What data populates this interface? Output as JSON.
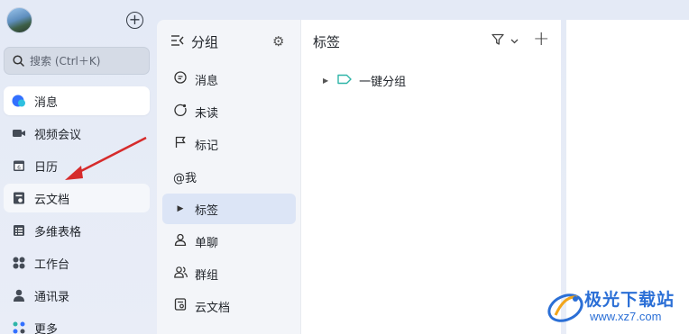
{
  "nav": {
    "search_placeholder": "搜索 (Ctrl＋K)",
    "items": [
      {
        "label": "消息",
        "icon": "message-icon"
      },
      {
        "label": "视频会议",
        "icon": "video-icon"
      },
      {
        "label": "日历",
        "icon": "calendar-icon"
      },
      {
        "label": "云文档",
        "icon": "document-icon"
      },
      {
        "label": "多维表格",
        "icon": "table-icon"
      },
      {
        "label": "工作台",
        "icon": "workspace-icon"
      },
      {
        "label": "通讯录",
        "icon": "contacts-icon"
      },
      {
        "label": "更多",
        "icon": "more-icon"
      }
    ],
    "calendar_day": "6"
  },
  "mid": {
    "title": "分组",
    "items": [
      {
        "label": "消息",
        "icon": "chat-bubble-icon"
      },
      {
        "label": "未读",
        "icon": "unread-icon"
      },
      {
        "label": "标记",
        "icon": "flag-icon"
      },
      {
        "label": "@我",
        "icon": "at-icon"
      },
      {
        "label": "标签",
        "icon": "expand-triangle-icon"
      },
      {
        "label": "单聊",
        "icon": "person-icon"
      },
      {
        "label": "群组",
        "icon": "group-icon"
      },
      {
        "label": "云文档",
        "icon": "doc-icon"
      }
    ]
  },
  "content": {
    "title": "标签",
    "group_label": "一键分组"
  },
  "watermark": {
    "name": "极光下载站",
    "url": "www.xz7.com"
  },
  "colors": {
    "accent": "#3370ff",
    "active_bg": "#dce5f6",
    "arrow": "#d62b2b",
    "tag": "#2fb5a8"
  }
}
